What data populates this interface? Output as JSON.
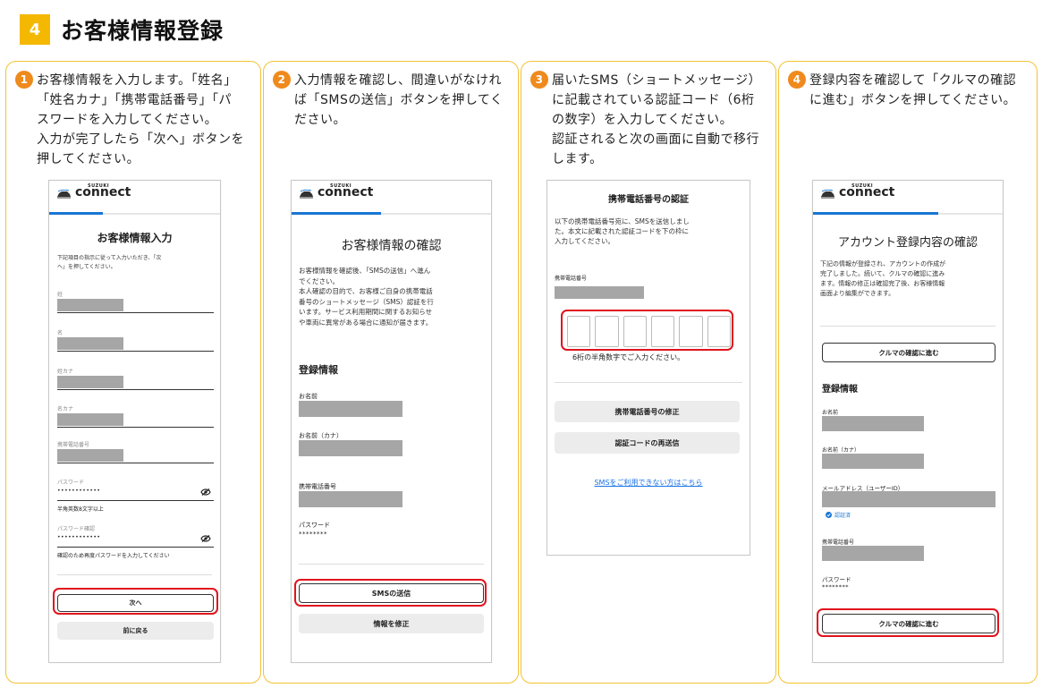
{
  "section": {
    "number": "4",
    "title": "お客様情報登録"
  },
  "colors": {
    "section_badge": "#f5b800",
    "step_badge": "#ef8a1d",
    "panel_border": "#f3c233",
    "highlight": "#e0141e",
    "progress": "#1976d2"
  },
  "steps": [
    {
      "num": "1",
      "lines": [
        "お客様情報を入力します。「姓名」",
        "「姓名カナ」「携帯電話番号」「パ",
        "スワードを入力してください。",
        "入力が完了したら「次へ」ボタンを",
        "押してください。"
      ]
    },
    {
      "num": "2",
      "lines": [
        "入力情報を確認し、間違いがなけれ",
        "ば「SMSの送信」ボタンを押してく",
        "ださい。"
      ]
    },
    {
      "num": "3",
      "lines": [
        "届いたSMS（ショートメッセージ）",
        "に記載されている認証コード（6桁",
        "の数字）を入力してください。",
        "認証されると次の画面に自動で移行",
        "します。"
      ]
    },
    {
      "num": "4",
      "lines": [
        "登録内容を確認して「クルマの確認",
        "に進む」ボタンを押してください。"
      ]
    }
  ],
  "brand": {
    "small": "SUZUKI",
    "name": "connect",
    "car_icon": "car-icon"
  },
  "screen1": {
    "title": "お客様情報入力",
    "intro": [
      "下記項目の指示に従って入力いただき、「次",
      "へ」を押してください。"
    ],
    "fields": [
      "姓",
      "名",
      "姓カナ",
      "名カナ",
      "携帯電話番号"
    ],
    "password_label": "パスワード",
    "password_value": "••••••••••••",
    "password_hint": "半角英数8文字以上",
    "password_confirm_label": "パスワード確認",
    "password_confirm_value": "••••••••••••",
    "password_confirm_hint": "確認のため再度パスワードを入力してください",
    "next_label": "次へ",
    "back_label": "前に戻る"
  },
  "screen2": {
    "title": "お客様情報の確認",
    "intro": [
      "お客様情報を確認後、「SMSの送信」へ進ん",
      "でください。",
      "本人確認の目的で、お客様ご自身の携帯電話",
      "番号のショートメッセージ（SMS）認証を行",
      "います。サービス利用期間に関するお知らせ",
      "や車両に異常がある場合に通知が届きます。"
    ],
    "section_label": "登録情報",
    "name_label": "お名前",
    "kana_label": "お名前（カナ）",
    "phone_label": "携帯電話番号",
    "password_label": "パスワード",
    "password_value": "********",
    "sms_label": "SMSの送信",
    "edit_label": "情報を修正"
  },
  "screen3": {
    "title": "携帯電話番号の認証",
    "intro": [
      "以下の携帯電話番号宛に、SMSを送信しまし",
      "た。本文に記載された認証コードを下の枠に",
      "入力してください。"
    ],
    "phone_label": "携帯電話番号",
    "code_hint": "6桁の半角数字でご入力ください。",
    "fix_label": "携帯電話番号の修正",
    "resend_label": "認証コードの再送信",
    "link_label": "SMSをご利用できない方はこちら"
  },
  "screen4": {
    "title": "アカウント登録内容の確認",
    "intro": [
      "下記の情報が登録され、アカウントの作成が",
      "完了しました。続いて、クルマの確認に進み",
      "ます。情報の修正は確認完了後、お客様情報",
      "画面より編集ができます。"
    ],
    "proceed_label": "クルマの確認に進む",
    "section_label": "登録情報",
    "name_label": "お名前",
    "kana_label": "お名前（カナ）",
    "email_label": "メールアドレス（ユーザーID）",
    "verified_label": "認証済",
    "phone_label": "携帯電話番号",
    "password_label": "パスワード",
    "password_value": "********",
    "proceed_label_bottom": "クルマの確認に進む"
  }
}
